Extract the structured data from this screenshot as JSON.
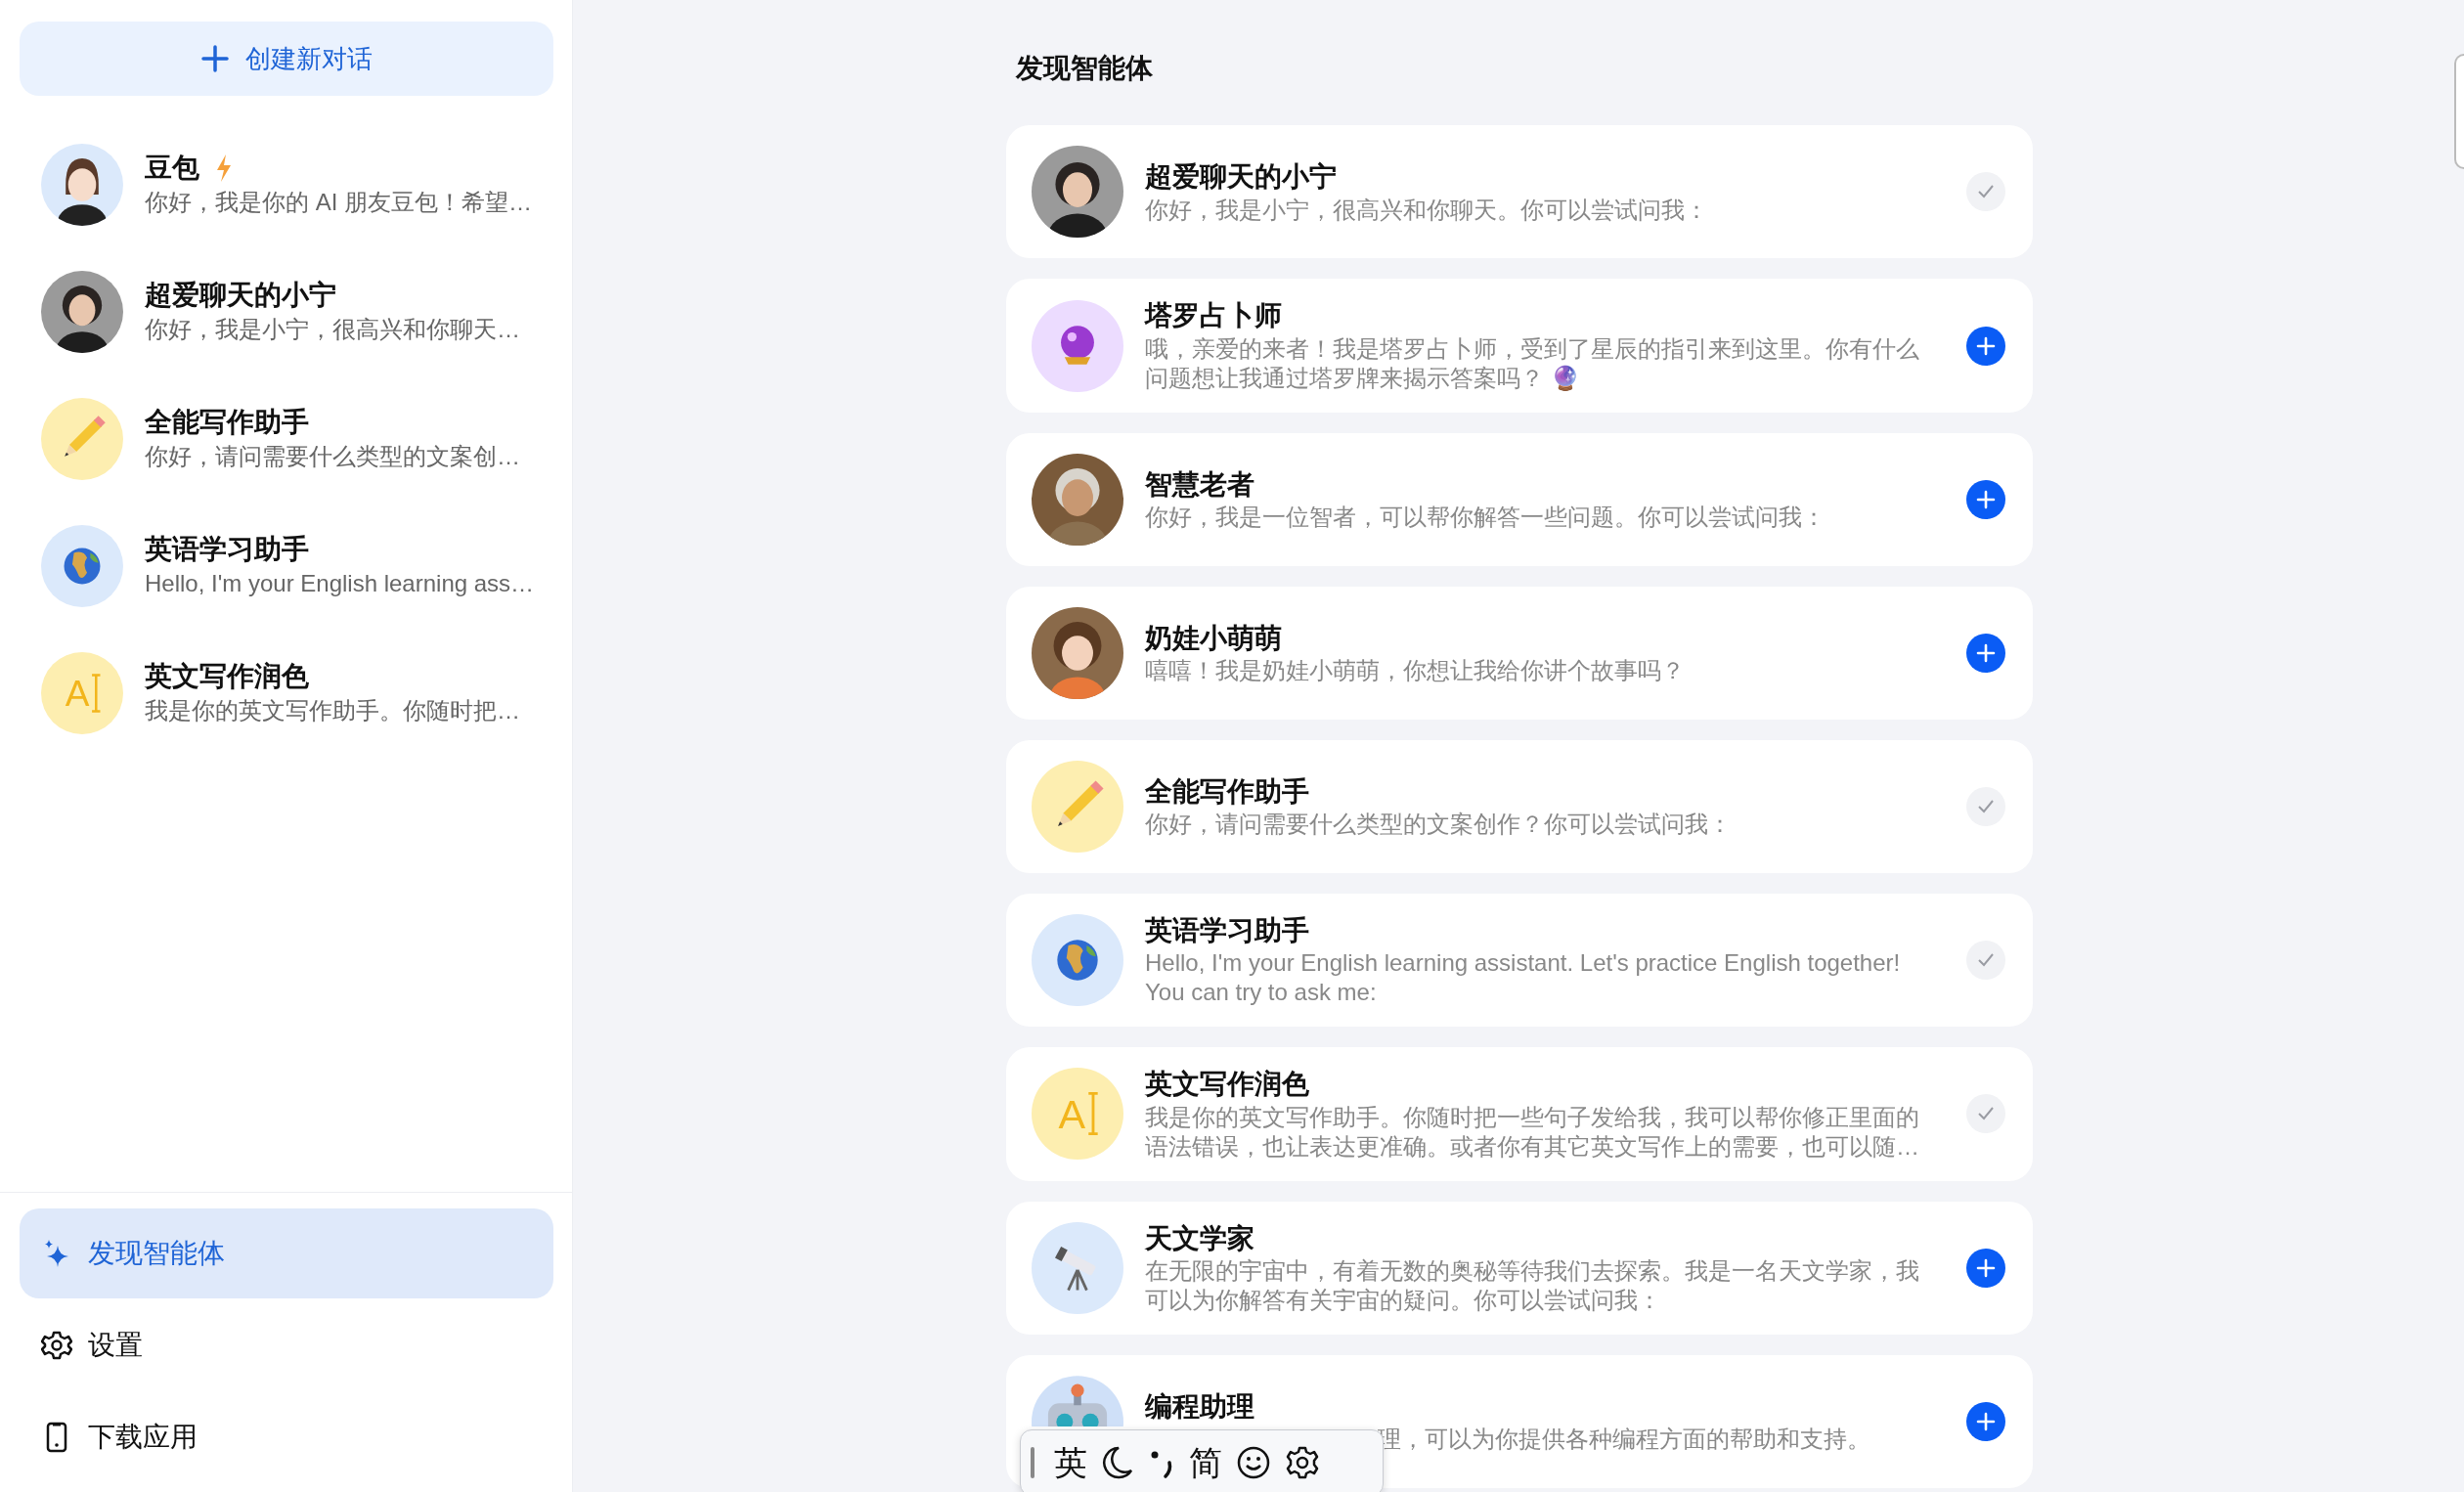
{
  "sidebar": {
    "new_chat_button": "创建新对话",
    "conversations": [
      {
        "name": "豆包",
        "preview": "你好，我是你的 AI 朋友豆包！希望…",
        "kind": "cartoon",
        "badge": true
      },
      {
        "name": "超爱聊天的小宁",
        "preview": "你好，我是小宁，很高兴和你聊天…",
        "kind": "person",
        "badge": false
      },
      {
        "name": "全能写作助手",
        "preview": "你好，请问需要什么类型的文案创…",
        "kind": "pencil",
        "badge": false
      },
      {
        "name": "英语学习助手",
        "preview": "Hello, I'm your English learning ass…",
        "kind": "globe",
        "badge": false
      },
      {
        "name": "英文写作润色",
        "preview": "我是你的英文写作助手。你随时把…",
        "kind": "letters",
        "avatar_text": "A",
        "badge": false
      }
    ],
    "nav": [
      {
        "label": "发现智能体",
        "selected": true
      },
      {
        "label": "设置",
        "selected": false
      },
      {
        "label": "下载应用",
        "selected": false
      }
    ]
  },
  "main": {
    "title": "发现智能体",
    "agents": [
      {
        "name": "超爱聊天的小宁",
        "description": "你好，我是小宁，很高兴和你聊天。你可以尝试问我：",
        "kind": "person",
        "added": true,
        "covered": false
      },
      {
        "name": "塔罗占卜师",
        "description": "哦，亲爱的来者！我是塔罗占卜师，受到了星辰的指引来到这里。你有什么问题想让我通过塔罗牌来揭示答案吗？ 🔮",
        "kind": "crystal-ball",
        "added": false,
        "covered": false
      },
      {
        "name": "智慧老者",
        "description": "你好，我是一位智者，可以帮你解答一些问题。你可以尝试问我：",
        "kind": "elder",
        "added": false,
        "covered": false
      },
      {
        "name": "奶娃小萌萌",
        "description": "嘻嘻！我是奶娃小萌萌，你想让我给你讲个故事吗？",
        "kind": "child",
        "added": false,
        "covered": false
      },
      {
        "name": "全能写作助手",
        "description": "你好，请问需要什么类型的文案创作？你可以尝试问我：",
        "kind": "pencil",
        "added": true,
        "covered": false
      },
      {
        "name": "英语学习助手",
        "description": "Hello, I'm your English learning assistant. Let's practice English together! You can try to ask me:",
        "kind": "globe",
        "added": true,
        "covered": false
      },
      {
        "name": "英文写作润色",
        "description": "我是你的英文写作助手。你随时把一些句子发给我，我可以帮你修正里面的语法错误，也让表达更准确。或者你有其它英文写作上的需要，也可以随…",
        "kind": "letters",
        "avatar_text": "A",
        "added": true,
        "covered": false
      },
      {
        "name": "天文学家",
        "description": "在无限的宇宙中，有着无数的奥秘等待我们去探索。我是一名天文学家，我可以为你解答有关宇宙的疑问。你可以尝试问我：",
        "kind": "telescope",
        "added": false,
        "covered": false
      },
      {
        "name": "编程助理",
        "description": "理，可以为你提供各种编程方面的帮助和支持。",
        "kind": "robot",
        "added": false,
        "covered": true
      }
    ]
  },
  "ime_toolbar": {
    "mode": "英",
    "script": "简"
  }
}
